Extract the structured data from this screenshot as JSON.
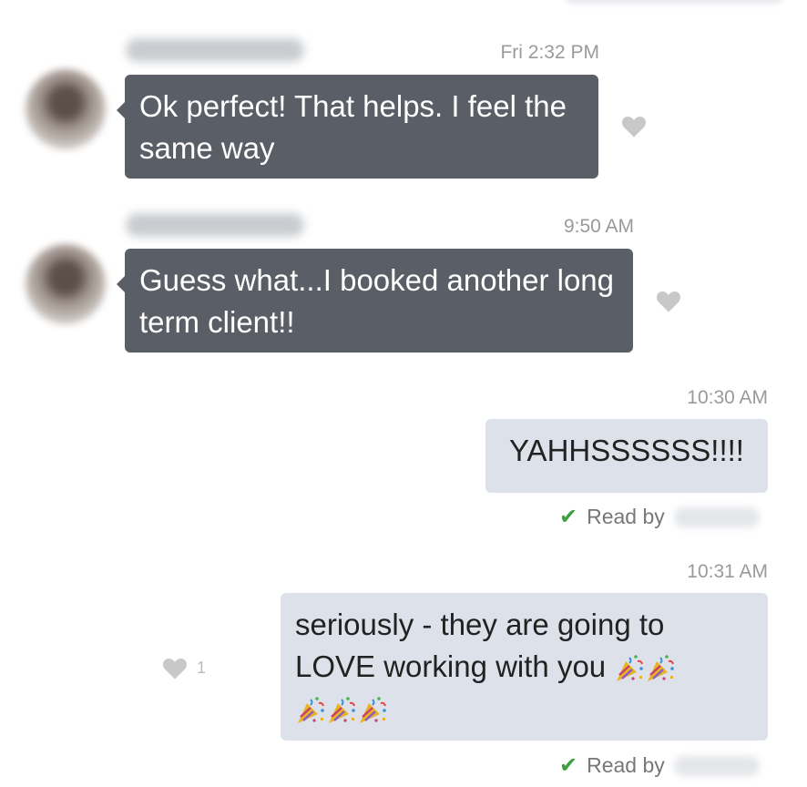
{
  "messages": [
    {
      "time": "Fri 2:32 PM",
      "text": "Ok perfect! That helps. I feel the same way",
      "direction": "incoming"
    },
    {
      "time": "9:50 AM",
      "text": "Guess what...I booked another long term client!!",
      "direction": "incoming"
    },
    {
      "time": "10:30 AM",
      "text": "YAHHSSSSSS!!!!",
      "direction": "outgoing",
      "receipt": "Read by"
    },
    {
      "time": "10:31 AM",
      "text_line1": "seriously - they are going to",
      "text_line2": "LOVE working with you",
      "emoji_icon": "party-popper-icon",
      "emoji_count_line2": 2,
      "emoji_count_line3": 3,
      "direction": "outgoing",
      "like_count": "1",
      "receipt": "Read by"
    }
  ],
  "colors": {
    "incoming_bubble": "#5a5e66",
    "outgoing_bubble": "#dde2ea",
    "read_check": "#3aa141",
    "heart": "#c8c8c8"
  }
}
